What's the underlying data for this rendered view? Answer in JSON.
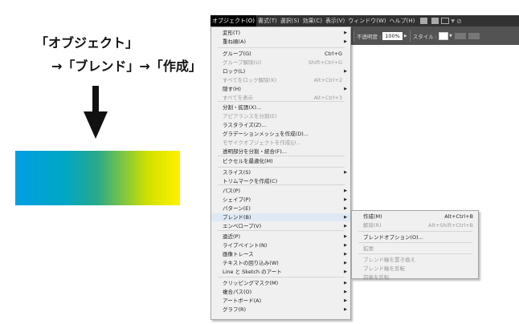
{
  "caption": {
    "line1": "「オブジェクト」",
    "line2": "→「ブレンド」→「作成」"
  },
  "colors": {
    "gradient_start": "#009fe3",
    "gradient_mid": "#2aa98a",
    "gradient_end": "#fff200",
    "menubar": "#323232",
    "menu_bg": "#f0f0f0"
  },
  "menubar": {
    "items": [
      "オブジェクト(O)",
      "書式(T)",
      "選択(S)",
      "効果(C)",
      "表示(V)",
      "ウィンドウ(W)",
      "ヘルプ(H)"
    ],
    "icons": [
      "bridge-icon",
      "stock-icon",
      "arrange-icon",
      "search-icon"
    ]
  },
  "toolbar": {
    "opacity_label": "不透明度 :",
    "opacity_value": "100%",
    "style_label": "スタイル :"
  },
  "menu": {
    "items": [
      {
        "label": "変形(T)",
        "shortcut": "",
        "sub": true,
        "disabled": false
      },
      {
        "label": "重ね順(A)",
        "shortcut": "",
        "sub": true,
        "disabled": false
      },
      {
        "label": "グループ(G)",
        "shortcut": "Ctrl+G",
        "sub": false,
        "disabled": false
      },
      {
        "label": "グループ解除(U)",
        "shortcut": "Shift+Ctrl+G",
        "sub": false,
        "disabled": true
      },
      {
        "label": "ロック(L)",
        "shortcut": "",
        "sub": true,
        "disabled": false
      },
      {
        "label": "すべてをロック解除(K)",
        "shortcut": "Alt+Ctrl+2",
        "sub": false,
        "disabled": true
      },
      {
        "label": "隠す(H)",
        "shortcut": "",
        "sub": true,
        "disabled": false
      },
      {
        "label": "すべてを表示",
        "shortcut": "Alt+Ctrl+3",
        "sub": false,
        "disabled": true
      },
      {
        "label": "分割・拡張(X)...",
        "shortcut": "",
        "sub": false,
        "disabled": false
      },
      {
        "label": "アピアランスを分割(E)",
        "shortcut": "",
        "sub": false,
        "disabled": true
      },
      {
        "label": "ラスタライズ(Z)...",
        "shortcut": "",
        "sub": false,
        "disabled": false
      },
      {
        "label": "グラデーションメッシュを作成(D)...",
        "shortcut": "",
        "sub": false,
        "disabled": false
      },
      {
        "label": "モザイクオブジェクトを作成(J)...",
        "shortcut": "",
        "sub": false,
        "disabled": true
      },
      {
        "label": "透明部分を分割・統合(F)...",
        "shortcut": "",
        "sub": false,
        "disabled": false
      },
      {
        "label": "ピクセルを最適化(M)",
        "shortcut": "",
        "sub": false,
        "disabled": false
      },
      {
        "label": "スライス(S)",
        "shortcut": "",
        "sub": true,
        "disabled": false
      },
      {
        "label": "トリムマークを作成(C)",
        "shortcut": "",
        "sub": false,
        "disabled": false
      },
      {
        "label": "パス(P)",
        "shortcut": "",
        "sub": true,
        "disabled": false
      },
      {
        "label": "シェイプ(P)",
        "shortcut": "",
        "sub": true,
        "disabled": false
      },
      {
        "label": "パターン(E)",
        "shortcut": "",
        "sub": true,
        "disabled": false
      },
      {
        "label": "ブレンド(B)",
        "shortcut": "",
        "sub": true,
        "disabled": false
      },
      {
        "label": "エンベロープ(V)",
        "shortcut": "",
        "sub": true,
        "disabled": false
      },
      {
        "label": "遠近(P)",
        "shortcut": "",
        "sub": true,
        "disabled": false
      },
      {
        "label": "ライブペイント(N)",
        "shortcut": "",
        "sub": true,
        "disabled": false
      },
      {
        "label": "画像トレース",
        "shortcut": "",
        "sub": true,
        "disabled": false
      },
      {
        "label": "テキストの回り込み(W)",
        "shortcut": "",
        "sub": true,
        "disabled": false
      },
      {
        "label": "Line と Sketch のアート",
        "shortcut": "",
        "sub": true,
        "disabled": false
      },
      {
        "label": "クリッピングマスク(M)",
        "shortcut": "",
        "sub": true,
        "disabled": false
      },
      {
        "label": "複合パス(O)",
        "shortcut": "",
        "sub": true,
        "disabled": false
      },
      {
        "label": "アートボード(A)",
        "shortcut": "",
        "sub": true,
        "disabled": false
      },
      {
        "label": "グラフ(R)",
        "shortcut": "",
        "sub": true,
        "disabled": false
      }
    ]
  },
  "submenu": {
    "items": [
      {
        "label": "作成(M)",
        "shortcut": "Alt+Ctrl+B",
        "disabled": false
      },
      {
        "label": "解除(R)",
        "shortcut": "Alt+Shift+Ctrl+B",
        "disabled": true
      },
      {
        "label": "ブレンドオプション(O)...",
        "shortcut": "",
        "disabled": false
      },
      {
        "label": "拡張",
        "shortcut": "",
        "disabled": true
      },
      {
        "label": "ブレンド軸を置き換え",
        "shortcut": "",
        "disabled": true
      },
      {
        "label": "ブレンド軸を反転",
        "shortcut": "",
        "disabled": true
      },
      {
        "label": "前後を反転",
        "shortcut": "",
        "disabled": true
      }
    ]
  }
}
